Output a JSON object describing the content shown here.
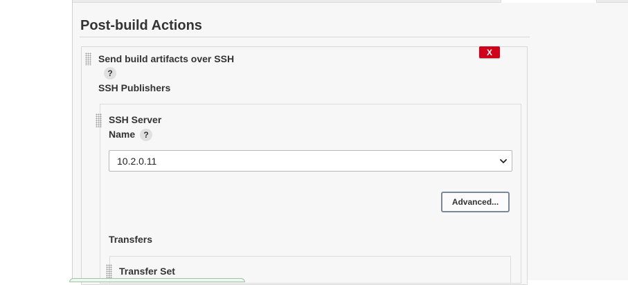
{
  "section": {
    "title": "Post-build Actions"
  },
  "action": {
    "title": "Send build artifacts over SSH",
    "help": "?",
    "remove_label": "X",
    "publishers_label": "SSH Publishers"
  },
  "ssh_server": {
    "title": "SSH Server",
    "name_label": "Name",
    "name_help": "?",
    "name_value": "10.2.0.11",
    "advanced_label": "Advanced..."
  },
  "transfers": {
    "label": "Transfers",
    "set_title": "Transfer Set"
  },
  "icons": {
    "drag": "drag-handle-icon",
    "select": "chevron-down-icon"
  },
  "colors": {
    "remove_red": "#d0021b"
  }
}
